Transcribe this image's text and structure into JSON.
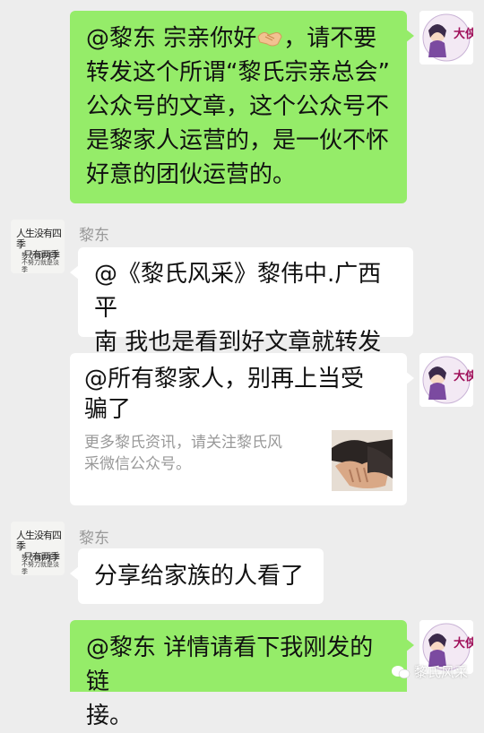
{
  "messages": [
    {
      "side": "right",
      "lines": [
        "@黎东 宗亲你好",
        "，请不要",
        "转发这个所谓“黎氏宗亲总会”",
        "公众号的文章，这个公众号不",
        "是黎家人运营的，是一伙不怀",
        "好意的团伙运营的。"
      ],
      "emoji": "handshake-emoji"
    },
    {
      "side": "left",
      "sender": "黎东",
      "lines": [
        "@《黎氏风采》黎伟中.广西平",
        "南 我也是看到好文章就转发了"
      ]
    },
    {
      "side": "right",
      "type": "link-card",
      "title_lines": [
        "@所有黎家人，别再上当受",
        "骗了"
      ],
      "desc_lines": [
        "更多黎氏资讯，请关注黎氏风",
        "采微信公众号。"
      ]
    },
    {
      "side": "left",
      "sender": "黎东",
      "lines": [
        "分享给家族的人看了"
      ]
    },
    {
      "side": "right",
      "lines": [
        "@黎东 详情请看下我刚发的链",
        "接。"
      ]
    }
  ],
  "avatars": {
    "right_label": "大侠",
    "left_callig_line1": "人生没有四季",
    "left_callig_line2": "只有两季",
    "left_callig_small1": "努力就是旺季",
    "left_callig_small2": "不努力就是淡季"
  },
  "watermark": {
    "label": "黎氏风采"
  },
  "colors": {
    "background": "#ededed",
    "green_bubble": "#95ec69",
    "white_bubble": "#ffffff",
    "sender_name": "#999999",
    "link_desc": "#999999"
  }
}
